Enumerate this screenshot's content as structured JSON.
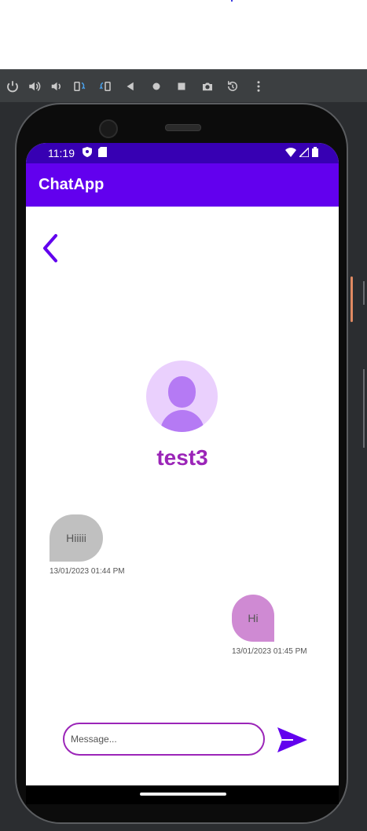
{
  "emulator": {
    "toolbar_icons": [
      "power-icon",
      "volume-up-icon",
      "volume-down-icon",
      "rotate-left-icon",
      "rotate-right-icon",
      "back-icon",
      "home-icon",
      "overview-icon",
      "camera-icon",
      "replay-icon",
      "more-icon"
    ]
  },
  "status_bar": {
    "time": "11:19"
  },
  "app_bar": {
    "title": "ChatApp"
  },
  "chat": {
    "user_name": "test3",
    "messages": [
      {
        "direction": "incoming",
        "text": "Hiiiii",
        "timestamp": "13/01/2023  01:44 PM"
      },
      {
        "direction": "outgoing",
        "text": "Hi",
        "timestamp": "13/01/2023  01:45 PM"
      }
    ]
  },
  "composer": {
    "placeholder": "Message...",
    "value": ""
  },
  "colors": {
    "primary": "#6200ee",
    "primary_dark": "#3700b3",
    "name_color": "#9b25b8",
    "incoming_bubble": "#c0c0c0",
    "outgoing_bubble": "#cf8ad3",
    "avatar_bg": "#ead0fd",
    "avatar_fg": "#b57af4"
  }
}
